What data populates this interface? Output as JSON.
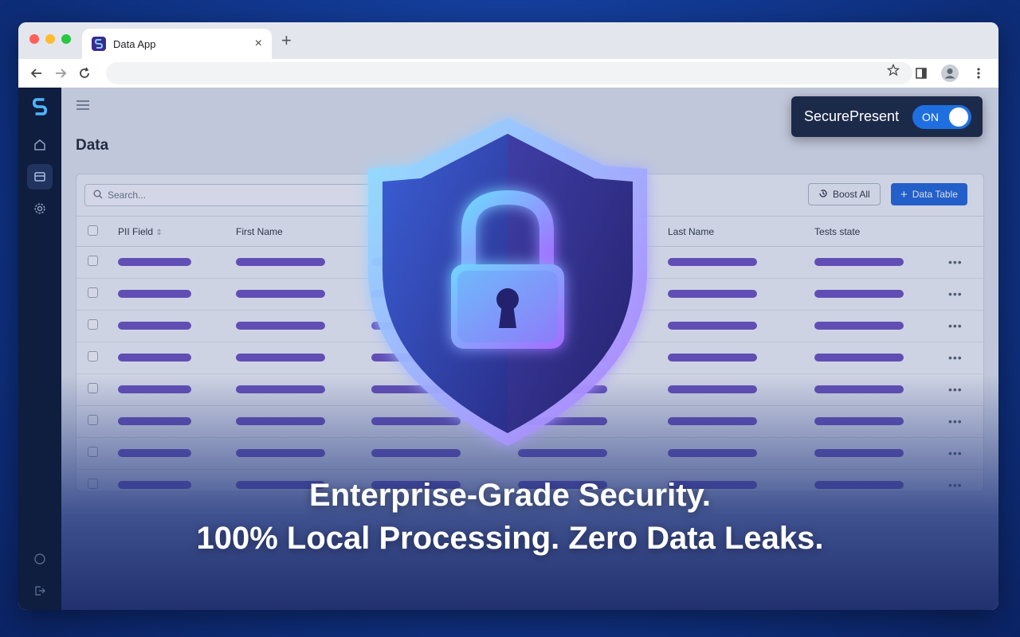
{
  "browser": {
    "tab_title": "Data App",
    "tab_close": "×",
    "new_tab": "+"
  },
  "app": {
    "page_title": "Data",
    "search_placeholder": "Search...",
    "boost_label": "Boost All",
    "add_table_label": "Data Table",
    "columns": [
      "PII Field",
      "First Name",
      "",
      "",
      "Last Name",
      "Tests state"
    ],
    "row_count": 8,
    "row_action": "•••"
  },
  "extension": {
    "name": "SecurePresent",
    "toggle_state": "ON"
  },
  "headline": {
    "line1": "Enterprise-Grade Security.",
    "line2": "100% Local Processing. Zero Data Leaks."
  },
  "colors": {
    "accent": "#1e63d6",
    "bar": "#6a4fbf",
    "shield_glow": "#6fd0ff"
  }
}
